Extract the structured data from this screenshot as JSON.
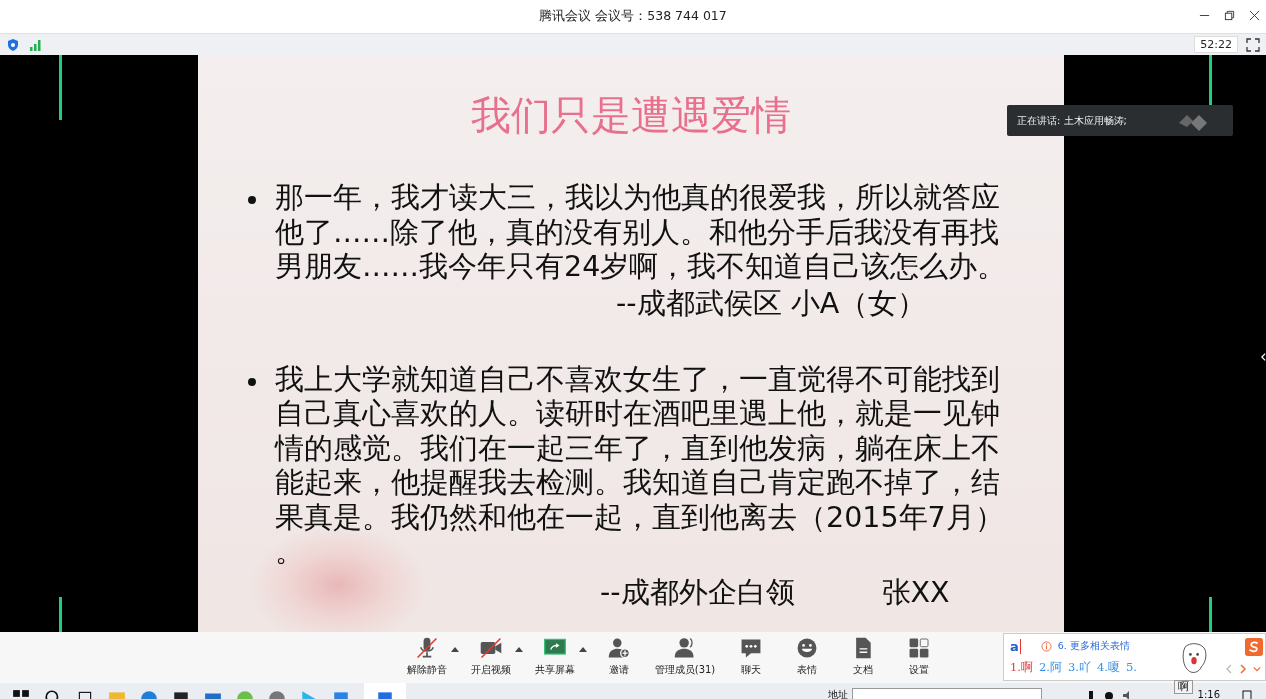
{
  "window": {
    "title": "腾讯会议 会议号：538 744 017"
  },
  "status_bar": {
    "timer": "52:22"
  },
  "slide": {
    "title": "我们只是遭遇爱情",
    "bullets": [
      {
        "lines": [
          "那一年，我才读大三，我以为他真的很爱我，所以就答应",
          "他了……除了他，真的没有别人。和他分手后我没有再找",
          "男朋友……我今年只有24岁啊，我不知道自己该怎么办。"
        ],
        "attribution": "--成都武侯区 小A（女）"
      },
      {
        "lines": [
          "我上大学就知道自己不喜欢女生了，一直觉得不可能找到",
          "自己真心喜欢的人。读研时在酒吧里遇上他，就是一见钟",
          "情的感觉。我们在一起三年了，直到他发病，躺在床上不",
          "能起来，他提醒我去检测。我知道自己肯定跑不掉了，结",
          "果真是。我仍然和他在一起，直到他离去（2015年7月）",
          "。"
        ],
        "attribution": "--成都外企白领　　　张XX"
      }
    ]
  },
  "speaker": {
    "label": "正在讲话: 土木应用畅涛;"
  },
  "toolbar": [
    {
      "kind": "mic",
      "label": "解除静音",
      "muted": true,
      "caret": true
    },
    {
      "kind": "video",
      "label": "开启视频",
      "muted": true,
      "caret": true
    },
    {
      "kind": "share",
      "label": "共享屏幕",
      "caret": true
    },
    {
      "kind": "invite",
      "label": "邀请"
    },
    {
      "kind": "members",
      "label": "管理成员(31)"
    },
    {
      "kind": "chat",
      "label": "聊天"
    },
    {
      "kind": "emoji",
      "label": "表情"
    },
    {
      "kind": "doc",
      "label": "文档"
    },
    {
      "kind": "settings",
      "label": "设置"
    }
  ],
  "ime": {
    "input": "a",
    "hint": "6. 更多相关表情",
    "candidates": [
      {
        "label": "1.啊",
        "selected": true
      },
      {
        "label": "2.阿",
        "selected": false
      },
      {
        "label": "3.吖",
        "selected": false
      },
      {
        "label": "4.嗄",
        "selected": false
      },
      {
        "label": "5.",
        "selected": false
      }
    ],
    "tooltip": "啊"
  },
  "taskbar": {
    "address_label": "地址",
    "clock": "1:16"
  }
}
